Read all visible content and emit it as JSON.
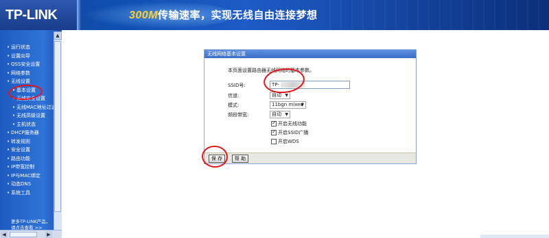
{
  "header": {
    "logo": "TP-LINK",
    "slogan_number": "300M",
    "slogan_text": "传输速率，实现无线自由连接梦想"
  },
  "sidebar": {
    "items": [
      {
        "label": "运行状态",
        "sub": false
      },
      {
        "label": "设置向导",
        "sub": false
      },
      {
        "label": "QSS安全设置",
        "sub": false
      },
      {
        "label": "网络参数",
        "sub": false
      },
      {
        "label": "无线设置",
        "sub": false
      },
      {
        "label": "基本设置",
        "sub": true,
        "active": true
      },
      {
        "label": "无线安全设置",
        "sub": true
      },
      {
        "label": "无线MAC地址过滤",
        "sub": true
      },
      {
        "label": "无线高级设置",
        "sub": true
      },
      {
        "label": "主机状态",
        "sub": true
      },
      {
        "label": "DHCP服务器",
        "sub": false
      },
      {
        "label": "转发规则",
        "sub": false
      },
      {
        "label": "安全设置",
        "sub": false
      },
      {
        "label": "路由功能",
        "sub": false
      },
      {
        "label": "IP带宽控制",
        "sub": false
      },
      {
        "label": "IP与MAC绑定",
        "sub": false
      },
      {
        "label": "动态DNS",
        "sub": false
      },
      {
        "label": "系统工具",
        "sub": false
      }
    ],
    "footer_line1": "更多TP-LINK产品，",
    "footer_line2": "请点击查看 >>"
  },
  "panel": {
    "title": "无线网络基本设置",
    "description": "本页面设置路由器无线网络的基本参数。",
    "ssid_label": "SSID号:",
    "ssid_value": "TP-",
    "channel_label": "信道:",
    "channel_value": "自动",
    "mode_label": "模式:",
    "mode_value": "11bgn mixed",
    "bandwidth_label": "频段带宽:",
    "bandwidth_value": "自动",
    "enable_wireless": "开启无线功能",
    "enable_ssid_broadcast": "开启SSID广播",
    "enable_wds": "开启WDS",
    "save_button": "保 存",
    "help_button": "帮 助"
  },
  "colors": {
    "annotation": "#e8141c",
    "sidebar": "#2f74d8",
    "header": "#0f4fb0"
  }
}
